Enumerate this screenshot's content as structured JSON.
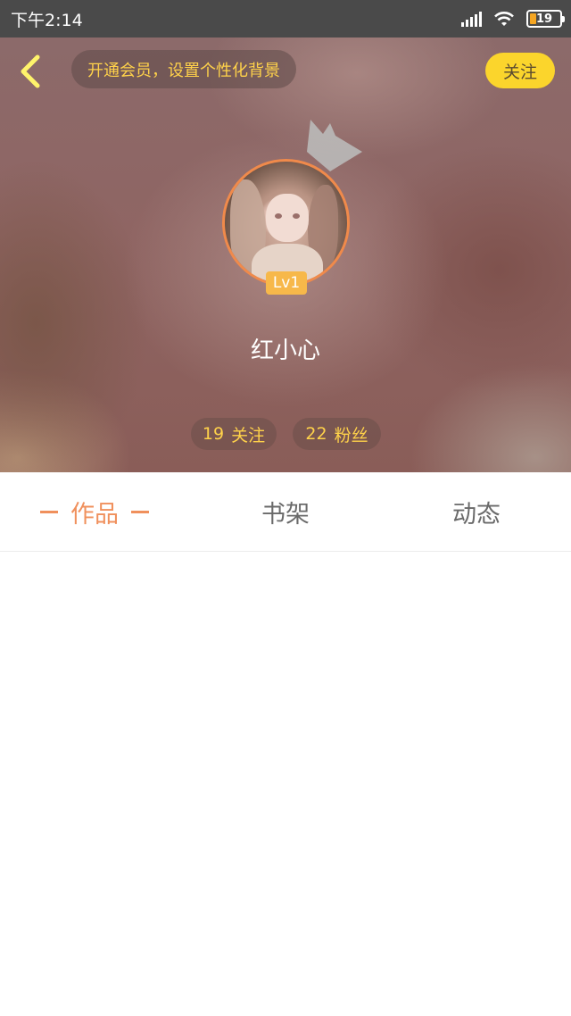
{
  "status_bar": {
    "time": "下午2:14",
    "battery_level": "19",
    "icons": [
      "signal-icon",
      "wifi-icon",
      "battery-icon"
    ]
  },
  "header": {
    "vip_prompt": "开通会员，设置个性化背景",
    "follow_label": "关注",
    "level": "Lv1",
    "username": "红小心",
    "stats": {
      "following_count": "19",
      "following_label": "关注",
      "fans_count": "22",
      "fans_label": "粉丝"
    },
    "icons": [
      "back-arrow-icon",
      "crown-icon"
    ]
  },
  "tabs": [
    {
      "label": "作品",
      "active": true
    },
    {
      "label": "书架",
      "active": false
    },
    {
      "label": "动态",
      "active": false
    }
  ],
  "colors": {
    "accent_orange": "#f0905c",
    "follow_yellow": "#fbd52c",
    "vip_text_yellow": "#ffd24a",
    "status_bar": "#4a4a4a"
  }
}
